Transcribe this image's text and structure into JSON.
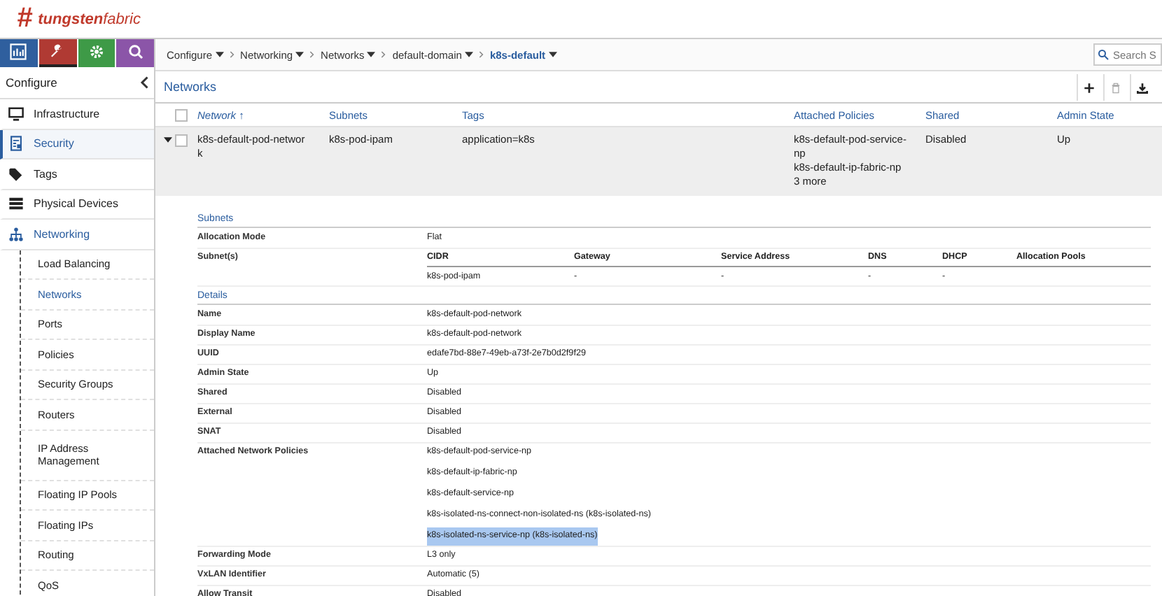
{
  "brand": {
    "mark": "#",
    "name_bold": "tungsten",
    "name_light": "fabric"
  },
  "top_tabs": [
    {
      "kind": "monitor",
      "selected": false,
      "color": "#2f5f9e"
    },
    {
      "kind": "wrench",
      "selected": true,
      "color": "#b03a33"
    },
    {
      "kind": "gear",
      "selected": false,
      "color": "#3e9a47"
    },
    {
      "kind": "search",
      "selected": false,
      "color": "#8b55a8"
    }
  ],
  "sidebar": {
    "title": "Configure",
    "items": [
      {
        "label": "Infrastructure",
        "kind": "monitor",
        "selected": false,
        "expanded": false
      },
      {
        "label": "Security",
        "kind": "shield",
        "selected": true,
        "expanded": false
      },
      {
        "label": "Tags",
        "kind": "tag",
        "selected": false,
        "expanded": false
      },
      {
        "label": "Physical Devices",
        "kind": "server",
        "selected": false,
        "expanded": false
      },
      {
        "label": "Networking",
        "kind": "network",
        "selected": false,
        "expanded": true,
        "children": [
          {
            "label": "Load Balancing",
            "selected": false
          },
          {
            "label": "Networks",
            "selected": true
          },
          {
            "label": "Ports",
            "selected": false
          },
          {
            "label": "Policies",
            "selected": false
          },
          {
            "label": "Security Groups",
            "selected": false
          },
          {
            "label": "Routers",
            "selected": false
          },
          {
            "label": "IP Address Management",
            "selected": false
          },
          {
            "label": "Floating IP Pools",
            "selected": false
          },
          {
            "label": "Floating IPs",
            "selected": false
          },
          {
            "label": "Routing",
            "selected": false
          },
          {
            "label": "QoS",
            "selected": false
          }
        ]
      }
    ]
  },
  "breadcrumb": [
    {
      "label": "Configure",
      "dropdown": true,
      "current": false
    },
    {
      "label": "Networking",
      "dropdown": true,
      "current": false
    },
    {
      "label": "Networks",
      "dropdown": true,
      "current": false
    },
    {
      "label": "default-domain",
      "dropdown": true,
      "current": false
    },
    {
      "label": "k8s-default",
      "dropdown": true,
      "current": true
    }
  ],
  "search": {
    "placeholder": "Search S"
  },
  "panel": {
    "title": "Networks",
    "actions": [
      {
        "kind": "add",
        "disabled": false
      },
      {
        "kind": "delete",
        "disabled": true
      },
      {
        "kind": "download",
        "disabled": false
      }
    ]
  },
  "table": {
    "all_checked": false,
    "columns": [
      {
        "label": "Network ↑",
        "sorted": true
      },
      {
        "label": "Subnets",
        "sorted": false
      },
      {
        "label": "Tags",
        "sorted": false
      },
      {
        "label": "Attached Policies",
        "sorted": false
      },
      {
        "label": "Shared",
        "sorted": false
      },
      {
        "label": "Admin State",
        "sorted": false
      }
    ],
    "rows": [
      {
        "expanded": true,
        "checked": false,
        "cells": [
          "k8s-default-pod-networ\nk",
          "k8s-pod-ipam",
          "application=k8s",
          "k8s-default-pod-service-\nnp\nk8s-default-ip-fabric-np\n3 more",
          "Disabled",
          "Up"
        ]
      }
    ]
  },
  "subnets": {
    "title": "Subnets",
    "allocation_label": "Allocation Mode",
    "allocation_value": "Flat",
    "subnet_label": "Subnet(s)",
    "columns": [
      "CIDR",
      "Gateway",
      "Service Address",
      "DNS",
      "DHCP",
      "Allocation Pools"
    ],
    "rows": [
      [
        "k8s-pod-ipam",
        "-",
        "-",
        "-",
        "-",
        ""
      ]
    ]
  },
  "details": {
    "title": "Details",
    "rows": [
      {
        "label": "Name",
        "values": [
          {
            "text": "k8s-default-pod-network",
            "highlighted": false
          }
        ]
      },
      {
        "label": "Display Name",
        "values": [
          {
            "text": "k8s-default-pod-network",
            "highlighted": false
          }
        ]
      },
      {
        "label": "UUID",
        "values": [
          {
            "text": "edafe7bd-88e7-49eb-a73f-2e7b0d2f9f29",
            "highlighted": false
          }
        ]
      },
      {
        "label": "Admin State",
        "values": [
          {
            "text": "Up",
            "highlighted": false
          }
        ]
      },
      {
        "label": "Shared",
        "values": [
          {
            "text": "Disabled",
            "highlighted": false
          }
        ]
      },
      {
        "label": "External",
        "values": [
          {
            "text": "Disabled",
            "highlighted": false
          }
        ]
      },
      {
        "label": "SNAT",
        "values": [
          {
            "text": "Disabled",
            "highlighted": false
          }
        ]
      },
      {
        "label": "Attached Network Policies",
        "values": [
          {
            "text": "k8s-default-pod-service-np",
            "highlighted": false
          },
          {
            "text": "k8s-default-ip-fabric-np",
            "highlighted": false
          },
          {
            "text": "k8s-default-service-np",
            "highlighted": false
          },
          {
            "text": "k8s-isolated-ns-connect-non-isolated-ns (k8s-isolated-ns)",
            "highlighted": false
          },
          {
            "text": "k8s-isolated-ns-service-np (k8s-isolated-ns)",
            "highlighted": true
          }
        ]
      },
      {
        "label": "Forwarding Mode",
        "values": [
          {
            "text": "L3 only",
            "highlighted": false
          }
        ]
      },
      {
        "label": "VxLAN Identifier",
        "values": [
          {
            "text": "Automatic (5)",
            "highlighted": false
          }
        ]
      },
      {
        "label": "Allow Transit",
        "values": [
          {
            "text": "Disabled",
            "highlighted": false
          }
        ]
      }
    ]
  }
}
